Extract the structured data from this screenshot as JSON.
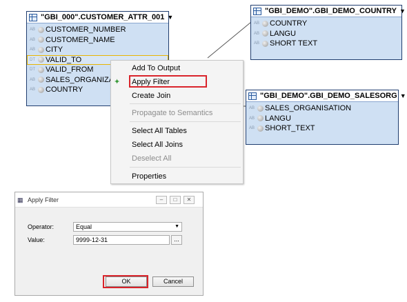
{
  "tables": {
    "customer_attr": {
      "title": "\"GBI_000\".CUSTOMER_ATTR_001",
      "columns": [
        {
          "type": "AB",
          "name": "CUSTOMER_NUMBER"
        },
        {
          "type": "AB",
          "name": "CUSTOMER_NAME"
        },
        {
          "type": "AB",
          "name": "CITY"
        },
        {
          "type": "DT",
          "name": "VALID_TO"
        },
        {
          "type": "DT",
          "name": "VALID_FROM"
        },
        {
          "type": "AB",
          "name": "SALES_ORGANIZAT"
        },
        {
          "type": "AB",
          "name": "COUNTRY"
        }
      ]
    },
    "demo_country": {
      "title": "\"GBI_DEMO\".GBI_DEMO_COUNTRY",
      "columns": [
        {
          "type": "AB",
          "name": "COUNTRY"
        },
        {
          "type": "AB",
          "name": "LANGU"
        },
        {
          "type": "AB",
          "name": "SHORT TEXT"
        }
      ]
    },
    "demo_salesorg": {
      "title": "\"GBI_DEMO\".GBI_DEMO_SALESORG",
      "columns": [
        {
          "type": "AB",
          "name": "SALES_ORGANISATION"
        },
        {
          "type": "AB",
          "name": "LANGU"
        },
        {
          "type": "AB",
          "name": "SHORT_TEXT"
        }
      ]
    }
  },
  "context_menu": {
    "items": [
      {
        "label": "Add To Output"
      },
      {
        "label": "Apply Filter"
      },
      {
        "label": "Create Join"
      },
      {
        "label": "Propagate to Semantics"
      },
      {
        "label": "Select All Tables"
      },
      {
        "label": "Select All Joins"
      },
      {
        "label": "Deselect All"
      },
      {
        "label": "Properties"
      }
    ]
  },
  "dialog": {
    "title": "Apply Filter",
    "operator_label": "Operator:",
    "operator_value": "Equal",
    "value_label": "Value:",
    "value": "9999-12-31",
    "browse_label": "...",
    "ok_label": "OK",
    "cancel_label": "Cancel"
  },
  "colors": {
    "highlight": "#d9232a",
    "table_body": "#cfe0f3",
    "table_border": "#1e3c6e"
  }
}
